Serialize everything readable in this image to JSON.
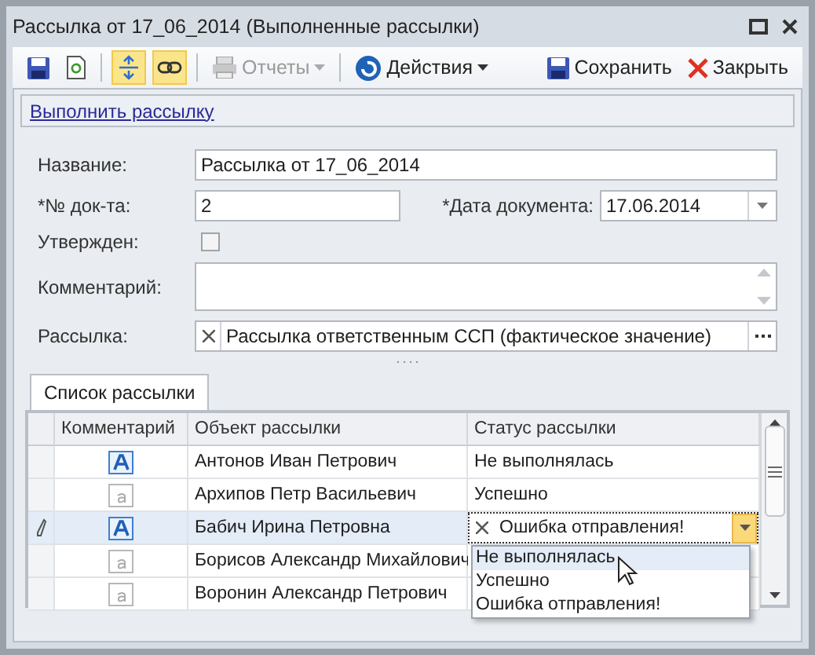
{
  "window": {
    "title": "Рассылка от 17_06_2014 (Выполненные рассылки)"
  },
  "toolbar": {
    "toggles": [
      {
        "pressed": true
      },
      {
        "pressed": true
      }
    ],
    "reports": {
      "label": "Отчеты",
      "disabled": true
    },
    "actions": {
      "label": "Действия"
    },
    "save": {
      "label": "Сохранить"
    },
    "close": {
      "label": "Закрыть"
    }
  },
  "link": "Выполнить рассылку",
  "form": {
    "name": {
      "label": "Название:",
      "value": "Рассылка от 17_06_2014"
    },
    "doc_number": {
      "label": "*№ док-та:",
      "value": "2"
    },
    "doc_date": {
      "label": "*Дата документа:",
      "value": "17.06.2014"
    },
    "approved": {
      "label": "Утвержден:",
      "checked": false
    },
    "comment": {
      "label": "Комментарий:"
    },
    "mailing": {
      "label": "Рассылка:",
      "value": "Рассылка ответственным ССП (фактическое значение)"
    }
  },
  "tabs": [
    {
      "label": "Список рассылки",
      "selected": true
    }
  ],
  "grid": {
    "columns": [
      "Комментарий",
      "Объект рассылки",
      "Статус рассылки"
    ],
    "rows": [
      {
        "has_comment": true,
        "object": "Антонов Иван Петрович",
        "status": "Не выполнялась",
        "selected": false
      },
      {
        "has_comment": false,
        "object": "Архипов Петр Васильевич",
        "status": "Успешно",
        "selected": false
      },
      {
        "has_comment": true,
        "object": "Бабич Ирина Петровна",
        "status": "Ошибка отправления!",
        "selected": true
      },
      {
        "has_comment": false,
        "object": "Борисов Александр Михайлович",
        "selected": false
      },
      {
        "has_comment": false,
        "object": "Воронин Александр Петрович",
        "selected": false
      }
    ],
    "dropdown": {
      "options": [
        {
          "label": "Не выполнялась",
          "selected": true
        },
        {
          "label": "Успешно",
          "selected": false
        },
        {
          "label": "Ошибка отправления!",
          "selected": false
        }
      ]
    }
  }
}
